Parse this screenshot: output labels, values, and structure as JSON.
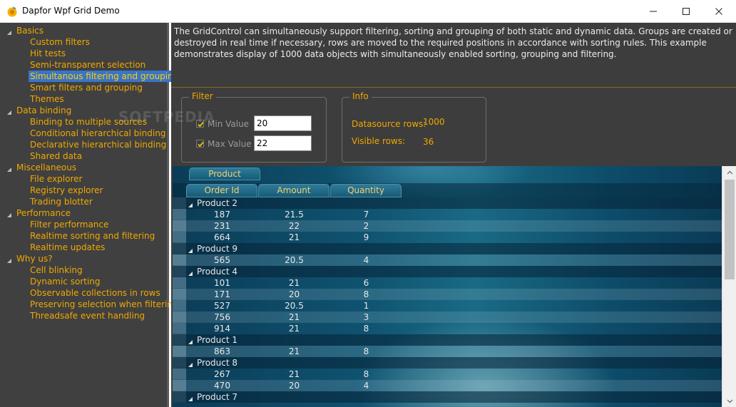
{
  "window": {
    "title": "Dapfor Wpf Grid Demo",
    "controls": {
      "minimize": "minimize-icon",
      "maximize": "maximize-icon",
      "close": "close-icon"
    }
  },
  "nav": {
    "categories": [
      {
        "label": "Basics",
        "items": [
          "Custom filters",
          "Hit tests",
          "Semi-transparent selection",
          "Simultanous filtering and grouping",
          "Smart filters and grouping",
          "Themes"
        ]
      },
      {
        "label": "Data binding",
        "items": [
          "Binding to multiple sources",
          "Conditional hierarchical binding",
          "Declarative hierarchical binding",
          "Shared data"
        ]
      },
      {
        "label": "Miscellaneous",
        "items": [
          "File explorer",
          "Registry explorer",
          "Trading blotter"
        ]
      },
      {
        "label": "Performance",
        "items": [
          "Filter performance",
          "Realtime sorting and filtering",
          "Realtime updates"
        ]
      },
      {
        "label": "Why us?",
        "items": [
          "Cell blinking",
          "Dynamic sorting",
          "Observable collections in rows",
          "Preserving selection when filtering",
          "Threadsafe event handling"
        ]
      }
    ],
    "selected": "Simultanous filtering and grouping"
  },
  "description": "The GridControl can simultaneously support filtering, sorting and grouping of both static and dynamic data. Groups are created or destroyed in real time if necessary, rows are moved to the required positions in accordance with sorting rules. This example demonstrates display of 1000 data objects with simultaneously enabled sorting, grouping and filtering.",
  "filter": {
    "title": "Filter",
    "min_label": "Min Value",
    "min_value": "20",
    "min_checked": true,
    "max_label": "Max Value",
    "max_value": "22",
    "max_checked": true
  },
  "info": {
    "title": "Info",
    "datasource_label": "Datasource rows:",
    "datasource_value": "1000",
    "visible_label": "Visible rows:",
    "visible_value": "36"
  },
  "grid": {
    "group_by": "Product",
    "columns": [
      "Order Id",
      "Amount",
      "Quantity"
    ],
    "groups": [
      {
        "name": "Product 2",
        "rows": [
          [
            "187",
            "21.5",
            "7"
          ],
          [
            "231",
            "22",
            "2"
          ],
          [
            "664",
            "21",
            "9"
          ]
        ]
      },
      {
        "name": "Product 9",
        "rows": [
          [
            "565",
            "20.5",
            "4"
          ]
        ]
      },
      {
        "name": "Product 4",
        "rows": [
          [
            "101",
            "21",
            "6"
          ],
          [
            "171",
            "20",
            "8"
          ],
          [
            "527",
            "20.5",
            "1"
          ],
          [
            "756",
            "21",
            "3"
          ],
          [
            "914",
            "21",
            "8"
          ]
        ]
      },
      {
        "name": "Product 1",
        "rows": [
          [
            "863",
            "21",
            "8"
          ]
        ]
      },
      {
        "name": "Product 8",
        "rows": [
          [
            "267",
            "21",
            "8"
          ],
          [
            "470",
            "20",
            "4"
          ]
        ]
      },
      {
        "name": "Product 7",
        "rows": []
      }
    ]
  },
  "watermark": "SOFTPEDIA",
  "colors": {
    "accent": "#f0a800",
    "selection": "#3a74c8",
    "panel": "#3d3d3d",
    "nav": "#404040"
  }
}
